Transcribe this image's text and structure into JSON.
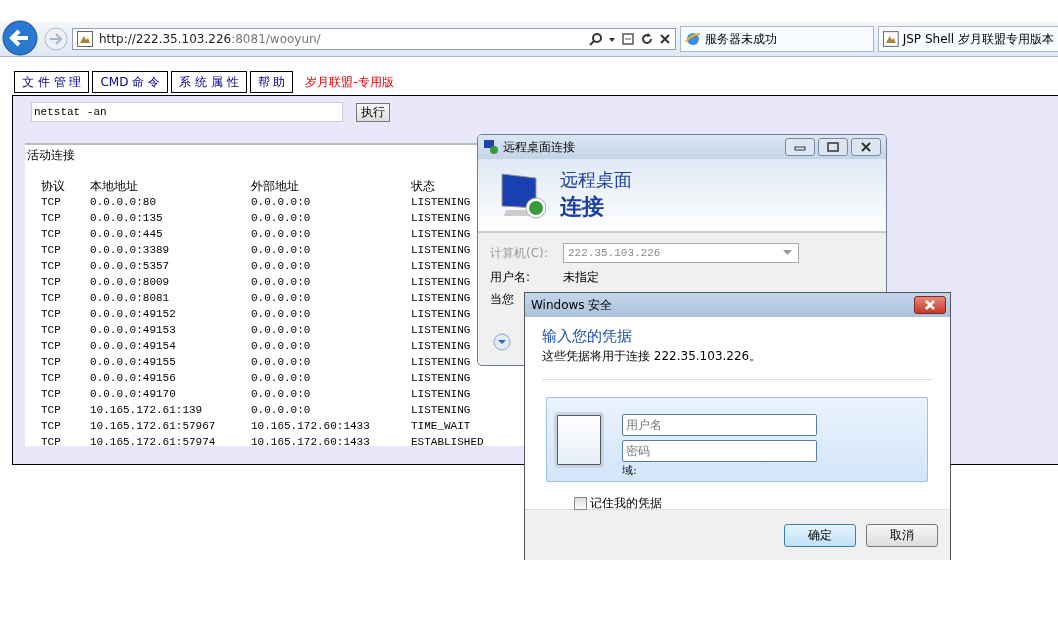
{
  "browser": {
    "address": {
      "host": "http://222.35.103.226",
      "path": ":8081/wooyun/"
    },
    "tabs": [
      {
        "label": "服务器未成功"
      },
      {
        "label": "JSP Shell 岁月联盟专用版本"
      }
    ]
  },
  "menu": {
    "items": [
      "文 件 管 理",
      "CMD 命 令",
      "系 统 属 性",
      "帮 助"
    ],
    "brand": "岁月联盟-专用版"
  },
  "command": {
    "value": "netstat -an",
    "button": "执行"
  },
  "output": {
    "title": "活动连接",
    "columns": [
      "协议",
      "本地地址",
      "外部地址",
      "状态"
    ],
    "rows": [
      [
        "TCP",
        "0.0.0.0:80",
        "0.0.0.0:0",
        "LISTENING"
      ],
      [
        "TCP",
        "0.0.0.0:135",
        "0.0.0.0:0",
        "LISTENING"
      ],
      [
        "TCP",
        "0.0.0.0:445",
        "0.0.0.0:0",
        "LISTENING"
      ],
      [
        "TCP",
        "0.0.0.0:3389",
        "0.0.0.0:0",
        "LISTENING"
      ],
      [
        "TCP",
        "0.0.0.0:5357",
        "0.0.0.0:0",
        "LISTENING"
      ],
      [
        "TCP",
        "0.0.0.0:8009",
        "0.0.0.0:0",
        "LISTENING"
      ],
      [
        "TCP",
        "0.0.0.0:8081",
        "0.0.0.0:0",
        "LISTENING"
      ],
      [
        "TCP",
        "0.0.0.0:49152",
        "0.0.0.0:0",
        "LISTENING"
      ],
      [
        "TCP",
        "0.0.0.0:49153",
        "0.0.0.0:0",
        "LISTENING"
      ],
      [
        "TCP",
        "0.0.0.0:49154",
        "0.0.0.0:0",
        "LISTENING"
      ],
      [
        "TCP",
        "0.0.0.0:49155",
        "0.0.0.0:0",
        "LISTENING"
      ],
      [
        "TCP",
        "0.0.0.0:49156",
        "0.0.0.0:0",
        "LISTENING"
      ],
      [
        "TCP",
        "0.0.0.0:49170",
        "0.0.0.0:0",
        "LISTENING"
      ],
      [
        "TCP",
        "10.165.172.61:139",
        "0.0.0.0:0",
        "LISTENING"
      ],
      [
        "TCP",
        "10.165.172.61:57967",
        "10.165.172.60:1433",
        "TIME_WAIT"
      ],
      [
        "TCP",
        "10.165.172.61:57974",
        "10.165.172.60:1433",
        "ESTABLISHED"
      ]
    ]
  },
  "rdp_dialog": {
    "title": "远程桌面连接",
    "heading_1": "远程桌面",
    "heading_2": "连接",
    "computer_label": "计算机(C):",
    "computer_value": "222.35.103.226",
    "user_label": "用户名:",
    "user_value": "未指定",
    "note": "当您"
  },
  "security_dialog": {
    "title": "Windows 安全",
    "heading": "输入您的凭据",
    "subtitle": "这些凭据将用于连接 222.35.103.226。",
    "username_placeholder": "用户名",
    "password_placeholder": "密码",
    "domain_label": "域:",
    "remember": {
      "label": "记住我的凭据",
      "checked": false
    },
    "buttons": [
      "确定",
      "取消"
    ]
  }
}
